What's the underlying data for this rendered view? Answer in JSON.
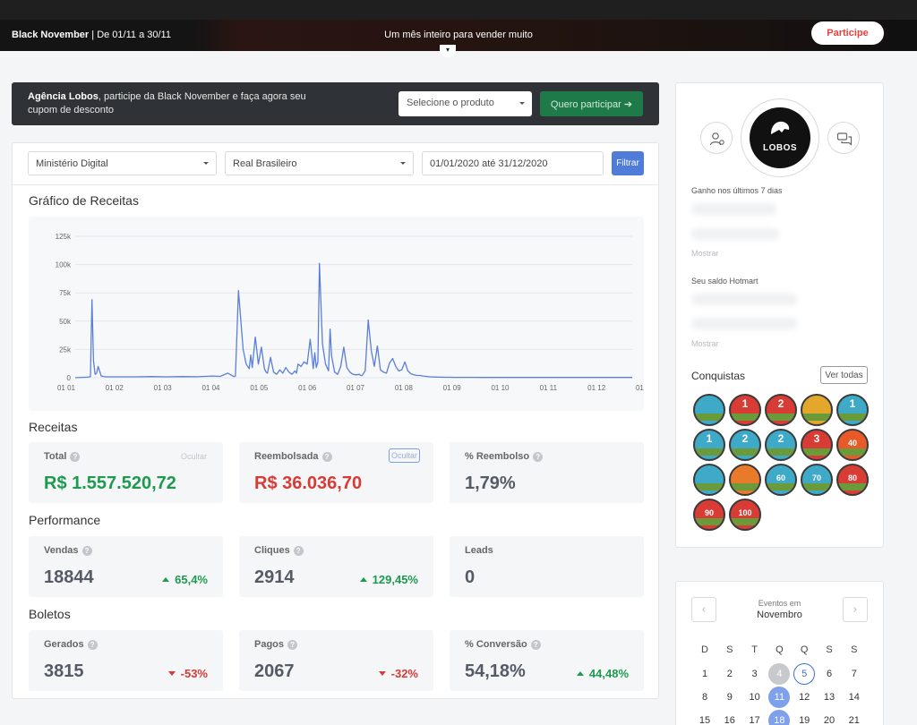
{
  "banner": {
    "campaign": "Black November",
    "dates": " | De 01/11 a 30/11",
    "tagline": "Um mês inteiro para vender muito",
    "cta": "Participe",
    "toggle_icon": "chevron-down-icon"
  },
  "promo": {
    "name": "Agência Lobos",
    "message": ", participe da Black November e faça agora seu cupom de desconto",
    "select_placeholder": "Selecione o produto",
    "button": "Quero participar ➔"
  },
  "filters": {
    "account": "Ministério Digital",
    "currency": "Real Brasileiro",
    "daterange": "01/01/2020 até 31/12/2020",
    "button": "Filtrar"
  },
  "chart_title": "Gráfico de Receitas",
  "chart_data": {
    "type": "line",
    "title": "Gráfico de Receitas",
    "xlabel": "",
    "ylabel": "",
    "ylim": [
      0,
      125000
    ],
    "grid": true,
    "x_ticks": [
      "01 01",
      "01 02",
      "01 03",
      "01 04",
      "01 05",
      "01 06",
      "01 07",
      "01 08",
      "01 09",
      "01 10",
      "01 11",
      "01 12",
      "01 01"
    ],
    "y_ticks": [
      "0",
      "25k",
      "50k",
      "75k",
      "100k",
      "125k"
    ],
    "color": "#5b7fd9",
    "series": [
      {
        "x": [
          0,
          8,
          10,
          11,
          12,
          13,
          14,
          15,
          17,
          20,
          30,
          40,
          50,
          60,
          70,
          80,
          90,
          95,
          100,
          104,
          105,
          107,
          110,
          112,
          114,
          115,
          116,
          118,
          120,
          122,
          124,
          125,
          126,
          128,
          130,
          132,
          134,
          136,
          138,
          140,
          142,
          144,
          145,
          146,
          148,
          150,
          152,
          154,
          156,
          157,
          158,
          159,
          160,
          162,
          164,
          166,
          167,
          168,
          170,
          172,
          174,
          176,
          178,
          180,
          182,
          184,
          186,
          187,
          188,
          190,
          192,
          194,
          196,
          198,
          200,
          202,
          204,
          206,
          208,
          210,
          212,
          214,
          216,
          218,
          220,
          222,
          224,
          226,
          228,
          230,
          232,
          234,
          236,
          238,
          240,
          242,
          244,
          246,
          248,
          250,
          252,
          254,
          256,
          258,
          260,
          262,
          264,
          266,
          268,
          270,
          272,
          274,
          276,
          278,
          280,
          282,
          285,
          290,
          295,
          300,
          303,
          305,
          310,
          320,
          330,
          340,
          350,
          360,
          365
        ],
        "y": [
          0,
          500,
          1000,
          69000,
          15000,
          3000,
          4000,
          10000,
          1500,
          800,
          800,
          800,
          1000,
          800,
          1000,
          900,
          1500,
          1200,
          4000,
          1000,
          1500,
          77000,
          25000,
          12000,
          8000,
          20000,
          9000,
          36000,
          12000,
          27000,
          8000,
          5000,
          4000,
          18000,
          5000,
          3000,
          7000,
          4000,
          9000,
          5000,
          3000,
          6000,
          4000,
          12000,
          10000,
          14000,
          12000,
          34000,
          8000,
          22000,
          9000,
          14000,
          101000,
          30000,
          12000,
          6000,
          43000,
          19000,
          5000,
          3000,
          10000,
          27000,
          9000,
          5000,
          3000,
          2500,
          3000,
          2000,
          2000,
          6000,
          51000,
          24000,
          10000,
          28000,
          7000,
          5000,
          4000,
          13000,
          17000,
          10000,
          6000,
          7000,
          14000,
          6000,
          3500,
          2500,
          2000,
          2000,
          1500,
          1200,
          900,
          700,
          600,
          500,
          500,
          400,
          400,
          400,
          300,
          300,
          300,
          300,
          300,
          300,
          300,
          300,
          300,
          200,
          200,
          200,
          200,
          200,
          200,
          200,
          200,
          200,
          200,
          200,
          200,
          200,
          200,
          200,
          200,
          200,
          200,
          200,
          200,
          200,
          200
        ]
      }
    ]
  },
  "receitas": {
    "title": "Receitas",
    "total": {
      "label": "Total",
      "value": "R$ 1.557.520,72",
      "hide": "Ocultar"
    },
    "reembolsada": {
      "label": "Reembolsada",
      "value": "R$ 36.036,70",
      "hide": "Ocultar"
    },
    "reembolso": {
      "label": "% Reembolso",
      "value": "1,79%"
    }
  },
  "performance": {
    "title": "Performance",
    "vendas": {
      "label": "Vendas",
      "value": "18844",
      "change": "65,4%"
    },
    "cliques": {
      "label": "Cliques",
      "value": "2914",
      "change": "129,45%"
    },
    "leads": {
      "label": "Leads",
      "value": "0"
    }
  },
  "boletos": {
    "title": "Boletos",
    "gerados": {
      "label": "Gerados",
      "value": "3815",
      "change": "-53%"
    },
    "pagos": {
      "label": "Pagos",
      "value": "2067",
      "change": "-32%"
    },
    "conversao": {
      "label": "% Conversão",
      "value": "54,18%",
      "change": "44,48%"
    }
  },
  "sidebar": {
    "brand": "LOBOS",
    "earned_label": "Ganho nos últimos 7 dias",
    "show": "Mostrar",
    "balance_label": "Seu saldo Hotmart",
    "achievements_title": "Conquistas",
    "see_all": "Ver todas",
    "badges": [
      {
        "text": "",
        "color": "#3fa9c8"
      },
      {
        "text": "1",
        "color": "#d93b35"
      },
      {
        "text": "2",
        "color": "#d93b35"
      },
      {
        "text": "",
        "color": "#e3a82b"
      },
      {
        "text": "1",
        "color": "#3fa9c8"
      },
      {
        "text": "1",
        "color": "#3fa9c8"
      },
      {
        "text": "2",
        "color": "#3fa9c8"
      },
      {
        "text": "2",
        "color": "#3fa9c8"
      },
      {
        "text": "3",
        "color": "#d93b35"
      },
      {
        "text": "40",
        "color": "#e85a2a"
      },
      {
        "text": "",
        "color": "#3fa9c8"
      },
      {
        "text": "",
        "color": "#e87a2a"
      },
      {
        "text": "60",
        "color": "#3fa9c8"
      },
      {
        "text": "70",
        "color": "#3fa9c8"
      },
      {
        "text": "80",
        "color": "#d93b35"
      },
      {
        "text": "90",
        "color": "#d93b35"
      },
      {
        "text": "100",
        "color": "#d93b35"
      }
    ]
  },
  "calendar": {
    "events_label": "Eventos em",
    "month": "Novembro",
    "weekdays": [
      "D",
      "S",
      "T",
      "Q",
      "Q",
      "S",
      "S"
    ],
    "rows": [
      [
        "1",
        "2",
        "3",
        "4",
        "5",
        "6",
        "7"
      ],
      [
        "8",
        "9",
        "10",
        "11",
        "12",
        "13",
        "14"
      ],
      [
        "15",
        "16",
        "17",
        "18",
        "19",
        "20",
        "21"
      ]
    ]
  }
}
